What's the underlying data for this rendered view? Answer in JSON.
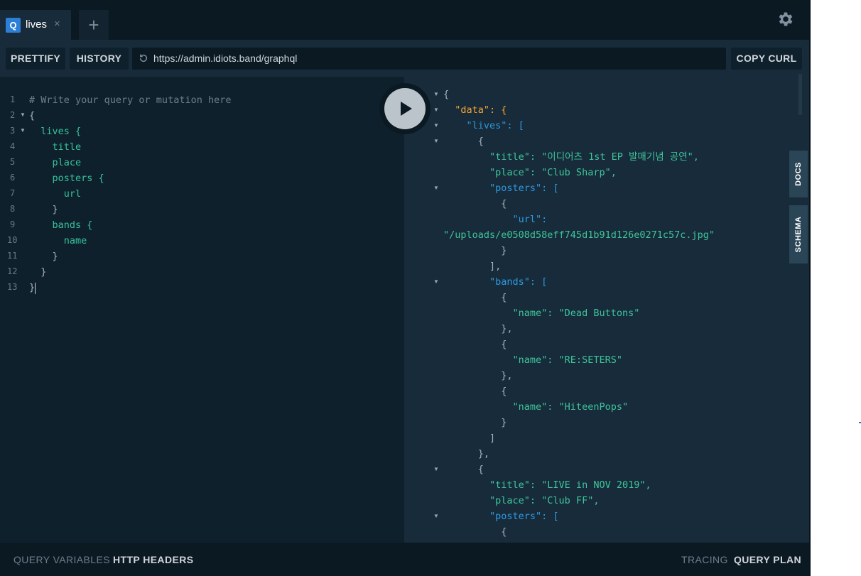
{
  "tabs": [
    {
      "badge": "Q",
      "label": "lives",
      "close": "×"
    }
  ],
  "add_tab_symbol": "+",
  "toolbar": {
    "prettify_label": "PRETTIFY",
    "history_label": "HISTORY",
    "endpoint_url": "https://admin.idiots.band/graphql",
    "copy_curl_label": "COPY CURL"
  },
  "editor": {
    "line_numbers": [
      "1",
      "2",
      "3",
      "4",
      "5",
      "6",
      "7",
      "8",
      "9",
      "10",
      "11",
      "12",
      "13"
    ],
    "lines": [
      "# Write your query or mutation here",
      "{",
      "  lives {",
      "    title",
      "    place",
      "    posters {",
      "      url",
      "    }",
      "    bands {",
      "      name",
      "    }",
      "  }",
      "}"
    ]
  },
  "result": {
    "lines": [
      "{",
      "  \"data\": {",
      "    \"lives\": [",
      "      {",
      "        \"title\": \"이디어츠 1st EP 발매기념 공연\",",
      "        \"place\": \"Club Sharp\",",
      "        \"posters\": [",
      "          {",
      "            \"url\":",
      "\"/uploads/e0508d58eff745d1b91d126e0271c57c.jpg\"",
      "          }",
      "        ],",
      "        \"bands\": [",
      "          {",
      "            \"name\": \"Dead Buttons\"",
      "          },",
      "          {",
      "            \"name\": \"RE:SETERS\"",
      "          },",
      "          {",
      "            \"name\": \"HiteenPops\"",
      "          }",
      "        ]",
      "      },",
      "      {",
      "        \"title\": \"LIVE in NOV 2019\",",
      "        \"place\": \"Club FF\",",
      "        \"posters\": [",
      "          {"
    ]
  },
  "side_tabs": {
    "docs": "DOCS",
    "schema": "SCHEMA"
  },
  "footer": {
    "query_variables": "QUERY VARIABLES",
    "http_headers": "HTTP HEADERS",
    "tracing": "TRACING",
    "query_plan": "QUERY PLAN"
  },
  "icons": {
    "gear": "gear-icon",
    "run": "play-icon",
    "history": "refresh-icon"
  },
  "colors": {
    "background": "#0f202d",
    "panel": "#172b3a",
    "field": "#37c29a",
    "key": "#2e9ae0",
    "data_key": "#f4a734",
    "badge": "#2b7fd6"
  }
}
